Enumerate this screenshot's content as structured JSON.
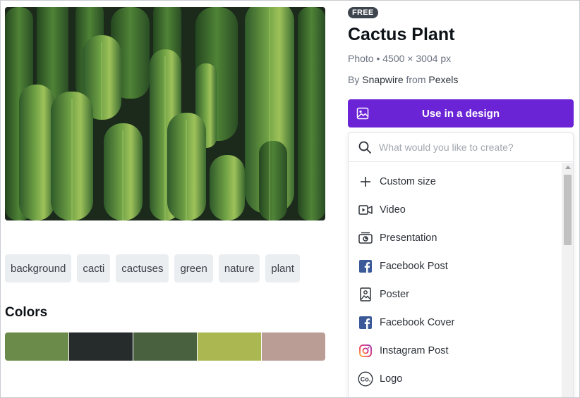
{
  "photo": {
    "alt": "Cactus Plant"
  },
  "tags": [
    "background",
    "cacti",
    "cactuses",
    "green",
    "nature",
    "plant"
  ],
  "colors": {
    "title": "Colors",
    "swatches": [
      "#6a8b4a",
      "#262b2b",
      "#4a6140",
      "#abb852",
      "#ba9e96"
    ]
  },
  "details": {
    "badge": "FREE",
    "title": "Cactus Plant",
    "meta": "Photo • 4500 × 3004 px",
    "by_prefix": "By",
    "author": "Snapwire",
    "from_word": "from",
    "source": "Pexels"
  },
  "use_button": {
    "label": "Use in a design",
    "icon": "image-icon",
    "color": "#6b23d6"
  },
  "dropdown": {
    "search_placeholder": "What would you like to create?",
    "items": [
      {
        "label": "Custom size",
        "icon": "plus-icon"
      },
      {
        "label": "Video",
        "icon": "video-icon"
      },
      {
        "label": "Presentation",
        "icon": "presentation-icon"
      },
      {
        "label": "Facebook Post",
        "icon": "facebook-icon"
      },
      {
        "label": "Poster",
        "icon": "poster-icon"
      },
      {
        "label": "Facebook Cover",
        "icon": "facebook-icon"
      },
      {
        "label": "Instagram Post",
        "icon": "instagram-icon"
      },
      {
        "label": "Logo",
        "icon": "logo-icon"
      }
    ]
  }
}
